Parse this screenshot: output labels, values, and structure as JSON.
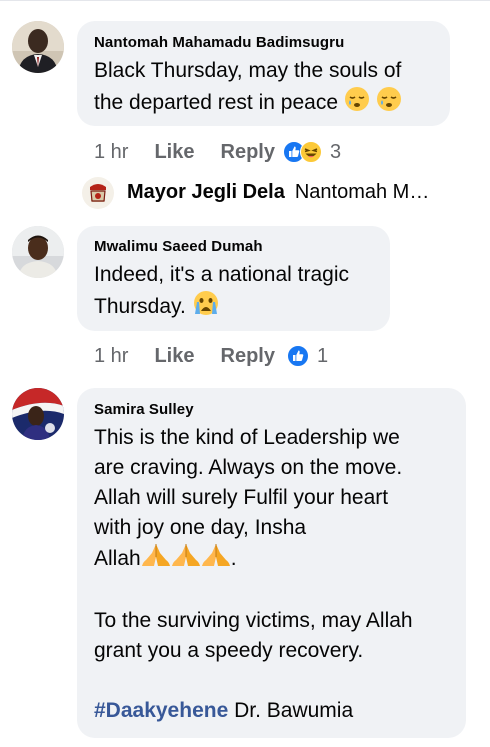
{
  "comments": [
    {
      "author": "Nantomah Mahamadu Badimsugru",
      "text": "Black Thursday, may the souls of the departed rest in peace",
      "line1": "Black Thursday, may the souls of",
      "line2": "the departed rest in peace",
      "emojis": [
        "sleepy-face-icon",
        "sleepy-face-icon"
      ],
      "time": "1 hr",
      "like_label": "Like",
      "reply_label": "Reply",
      "reaction_icons": [
        "like-reaction-icon",
        "haha-reaction-icon"
      ],
      "reaction_count": "3",
      "replies": [
        {
          "author": "Mayor Jegli Dela",
          "preview": "Nantomah M…"
        }
      ]
    },
    {
      "author": "Mwalimu Saeed Dumah",
      "line1": "Indeed, it's a national tragic",
      "line2": "Thursday.",
      "emojis": [
        "crying-face-icon"
      ],
      "time": "1 hr",
      "like_label": "Like",
      "reply_label": "Reply",
      "reaction_icons": [
        "like-reaction-icon"
      ],
      "reaction_count": "1"
    },
    {
      "author": "Samira Sulley",
      "lines": [
        "This is the kind of Leadership we",
        "are craving. Always on the move.",
        "Allah will surely Fulfil your heart",
        "with joy one day, Insha",
        "Allah",
        "To the surviving victims, may Allah",
        "grant you a speedy recovery."
      ],
      "line5_suffix": ".",
      "emojis": [
        "folded-hands-icon",
        "folded-hands-icon",
        "folded-hands-icon"
      ],
      "hashtag": "#Daakyehene",
      "tag_suffix": " Dr. Bawumia"
    }
  ],
  "colors": {
    "bubble": "#f0f2f5",
    "meta_text": "#65676b",
    "like_blue": "#1877f2",
    "hashtag": "#385898"
  }
}
